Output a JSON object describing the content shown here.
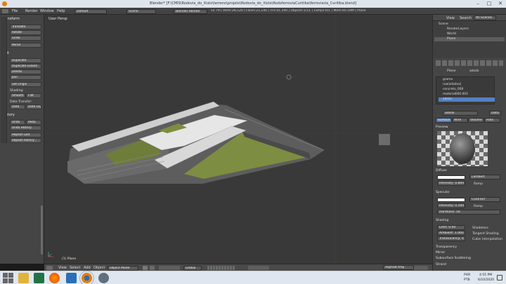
{
  "titlebar": {
    "title": "Blender* [F:\\CMIS\\Rodovia_do_Xisto\\terreno\\projeto\\Rodovia_do_Xisto\\RodoferroviaCuritiba\\ferroviaria_Curitiba.blend]"
  },
  "menubar": {
    "items": [
      "File",
      "Render",
      "Window",
      "Help"
    ],
    "screen": "Default",
    "scene": "Scene",
    "engine": "Blender Render",
    "stats": "v2.79 | Verts:28,120 | Faces:21,140 | Tris:41,340 | Objects:1/11 | Lamps:0/1 | Mem:95.59M | Plane"
  },
  "toolshelf": {
    "transform_header": "Transform",
    "transform_buttons": [
      "Translate",
      "Rotate",
      "Scale",
      "Mirror"
    ],
    "edit_header": "Edit",
    "edit_buttons": [
      "Duplicate",
      "Duplicate Linked",
      "Delete",
      "Join"
    ],
    "set_origin": "Set Origin",
    "shading_label": "Shading:",
    "shading_buttons": [
      "Smooth",
      "Flat"
    ],
    "data_transfer_label": "Data Transfer:",
    "data_buttons": [
      "Data",
      "Data Lay"
    ],
    "history_header": "History",
    "history_buttons": [
      "Undo",
      "Redo",
      "Undo History",
      "Repeat Last",
      "Repeat History..."
    ]
  },
  "viewport": {
    "label": "User Persp",
    "object_label": "(1) Plane"
  },
  "view_header": {
    "menus": [
      "View",
      "Select",
      "Add",
      "Object"
    ],
    "mode": "Object Mode",
    "pivot": "Global"
  },
  "outliner": {
    "menus": [
      "View",
      "Search",
      "All Scenes"
    ],
    "tree": [
      "Scene",
      "RenderLayers",
      "World",
      "Plane"
    ]
  },
  "properties": {
    "breadcrumb": [
      "Plane",
      "adsdx"
    ],
    "material_slots": [
      "grama",
      "rua(adadxa)",
      "concreto_008",
      "material000.003",
      "adsdx"
    ],
    "material_name": "adsdx",
    "data_label": "Data",
    "tabs": [
      "Surface",
      "Wire",
      "Volume",
      "Halo"
    ],
    "preview_header": "Preview",
    "diffuse_header": "Diffuse",
    "diffuse_shader": "Lambert",
    "diffuse_intensity": "Intensity: 0.800",
    "diffuse_ramp": "Ramp",
    "specular_header": "Specular",
    "specular_shader": "CookTorr",
    "specular_intensity": "Intensity: 0.500",
    "specular_ramp": "Ramp",
    "hardness": "Hardness: 50",
    "shading_header": "Shading",
    "emit": "Emit: 0.00",
    "ambient": "Ambient: 1.000",
    "translucency": "Translucency: 0.000",
    "shading_checks": [
      "Shadeless",
      "Tangent Shading",
      "Cubic Interpolation"
    ],
    "collapsed_panels": [
      "Transparency",
      "Mirror",
      "Subsurface Scattering",
      "Strand"
    ],
    "bottom_field": "Asphalt.tmp"
  },
  "taskbar": {
    "lang": "POR",
    "lang2": "PTB",
    "time": "4:55 PM",
    "date": "6/10/2020"
  },
  "colors": {
    "viewport_bg": "#393939",
    "panel_bg": "#454545",
    "selection": "#5680c2",
    "grass": "#7d8d41",
    "titlebar": "#dfe5ec"
  }
}
